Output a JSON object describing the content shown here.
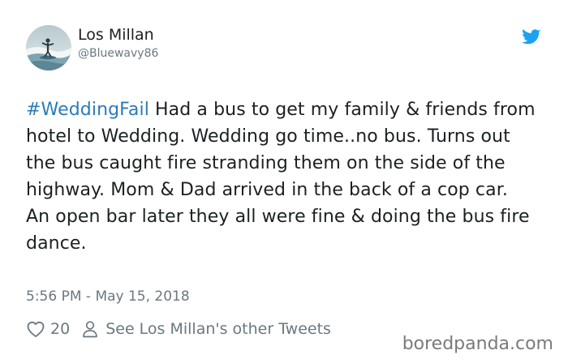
{
  "author": {
    "name": "Los Millan",
    "handle": "@Bluewavy86",
    "avatar_icon": "surfer-avatar"
  },
  "brand_icon": "twitter-bird-icon",
  "tweet": {
    "hashtag": "#WeddingFail",
    "paragraph1_rest": " Had a bus to get my family & friends from hotel to Wedding. Wedding go time..no bus. Turns out the bus caught fire stranding them on the side of the highway. Mom & Dad arrived in the back of a cop car.",
    "paragraph2": "An open bar later they all were fine & doing the bus fire dance."
  },
  "timestamp": "5:56 PM - May 15, 2018",
  "actions": {
    "likes_count": "20",
    "other_tweets_label": "See Los Millan's other Tweets"
  },
  "watermark": "boredpanda.com",
  "colors": {
    "hashtag": "#2b7bb9",
    "twitter_blue": "#1da1f2",
    "muted": "#697882"
  }
}
